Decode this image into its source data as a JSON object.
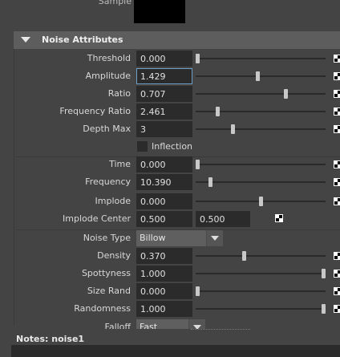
{
  "sample": {
    "label": "Sample"
  },
  "section": {
    "title": "Noise Attributes"
  },
  "attributes": [
    {
      "label": "Threshold",
      "value": "0.000",
      "slider": 0.0
    },
    {
      "label": "Amplitude",
      "value": "1.429",
      "slider": 0.48,
      "focused": true
    },
    {
      "label": "Ratio",
      "value": "0.707",
      "slider": 0.7
    },
    {
      "label": "Frequency Ratio",
      "value": "2.461",
      "slider": 0.16
    },
    {
      "label": "Depth Max",
      "value": "3",
      "slider": 0.28
    }
  ],
  "inflection": {
    "label": "Inflection",
    "checked": false
  },
  "attributes2": [
    {
      "label": "Time",
      "value": "0.000",
      "slider": 0.0
    },
    {
      "label": "Frequency",
      "value": "10.390",
      "slider": 0.1
    },
    {
      "label": "Implode",
      "value": "0.000",
      "slider": 0.5
    }
  ],
  "implode_center": {
    "label": "Implode Center",
    "x": "0.500",
    "y": "0.500"
  },
  "noise_type": {
    "label": "Noise Type",
    "value": "Billow"
  },
  "attributes3": [
    {
      "label": "Density",
      "value": "0.370",
      "slider": 0.37
    },
    {
      "label": "Spottyness",
      "value": "1.000",
      "slider": 1.0
    },
    {
      "label": "Size Rand",
      "value": "0.000",
      "slider": 0.0
    },
    {
      "label": "Randomness",
      "value": "1.000",
      "slider": 1.0
    }
  ],
  "falloff": {
    "label": "Falloff",
    "value": "Fast"
  },
  "notes": {
    "label": "Notes:  noise1"
  }
}
